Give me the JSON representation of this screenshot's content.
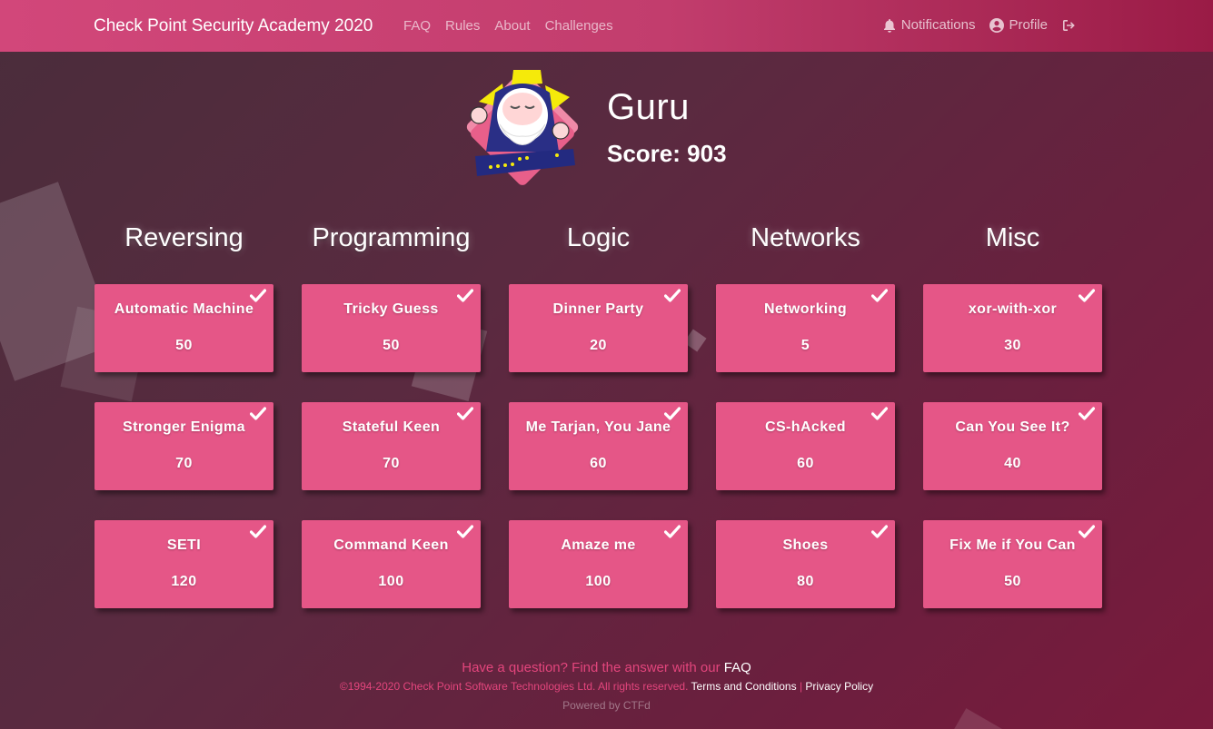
{
  "nav": {
    "brand": "Check Point Security Academy 2020",
    "links": [
      "FAQ",
      "Rules",
      "About",
      "Challenges"
    ],
    "notifications_label": "Notifications",
    "profile_label": "Profile"
  },
  "user": {
    "name": "Guru",
    "score_label": "Score:",
    "score": "903"
  },
  "categories": [
    {
      "title": "Reversing",
      "challenges": [
        {
          "name": "Automatic Machine",
          "value": "50"
        },
        {
          "name": "Stronger Enigma",
          "value": "70"
        },
        {
          "name": "SETI",
          "value": "120"
        }
      ]
    },
    {
      "title": "Programming",
      "challenges": [
        {
          "name": "Tricky Guess",
          "value": "50"
        },
        {
          "name": "Stateful Keen",
          "value": "70"
        },
        {
          "name": "Command Keen",
          "value": "100"
        }
      ]
    },
    {
      "title": "Logic",
      "challenges": [
        {
          "name": "Dinner Party",
          "value": "20"
        },
        {
          "name": "Me Tarjan, You Jane",
          "value": "60"
        },
        {
          "name": "Amaze me",
          "value": "100"
        }
      ]
    },
    {
      "title": "Networks",
      "challenges": [
        {
          "name": "Networking",
          "value": "5"
        },
        {
          "name": "CS-hAcked",
          "value": "60"
        },
        {
          "name": "Shoes",
          "value": "80"
        }
      ]
    },
    {
      "title": "Misc",
      "challenges": [
        {
          "name": "xor-with-xor",
          "value": "30"
        },
        {
          "name": "Can You See It?",
          "value": "40"
        },
        {
          "name": "Fix Me if You Can",
          "value": "50"
        }
      ]
    }
  ],
  "footer": {
    "question": "Have a question? Find the answer with our",
    "faq_link": "FAQ",
    "copyright": "©1994-2020 Check Point Software Technologies Ltd. All rights reserved.",
    "terms": "Terms and Conditions",
    "separator": "|",
    "privacy": "Privacy Policy",
    "powered": "Powered by CTFd"
  },
  "colors": {
    "card": "#e55687",
    "nav_start": "#d2477a",
    "nav_end": "#9a1b46",
    "accent": "#e2457c"
  },
  "icons": [
    "bell-icon",
    "user-circle-icon",
    "logout-icon",
    "checkmark-icon"
  ]
}
